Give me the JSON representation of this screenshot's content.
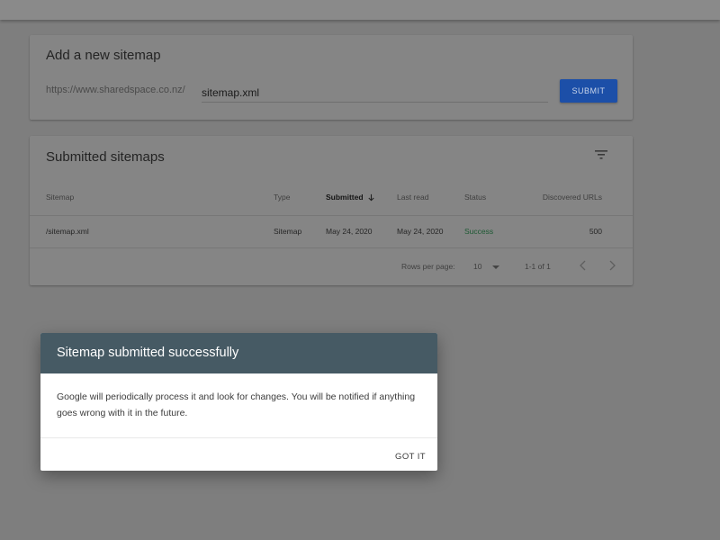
{
  "add_sitemap": {
    "title": "Add a new sitemap",
    "url_prefix": "https://www.sharedspace.co.nz/",
    "input_value": "sitemap.xml",
    "submit_label": "SUBMIT"
  },
  "submitted": {
    "title": "Submitted sitemaps",
    "filter_icon": "filter-icon",
    "columns": [
      "Sitemap",
      "Type",
      "Submitted",
      "Last read",
      "Status",
      "Discovered URLs"
    ],
    "sort_column": "Submitted",
    "sort_direction": "descending",
    "rows": [
      {
        "sitemap": "/sitemap.xml",
        "type": "Sitemap",
        "submitted": "May 24, 2020",
        "last_read": "May 24, 2020",
        "status": "Success",
        "discovered_urls": "500"
      }
    ],
    "footer": {
      "rows_per_page_label": "Rows per page:",
      "rows_per_page_value": "10",
      "range_label": "1-1 of 1"
    }
  },
  "dialog": {
    "title": "Sitemap submitted successfully",
    "body": "Google will periodically process it and look for changes. You will be notified if anything goes wrong with it in the future.",
    "button_label": "GOT IT"
  },
  "colors": {
    "overlay_background": "#7e7e7e",
    "dialog_header": "#465a64",
    "submit_button": "#1c4fa8",
    "status_success": "#1e5a34"
  }
}
